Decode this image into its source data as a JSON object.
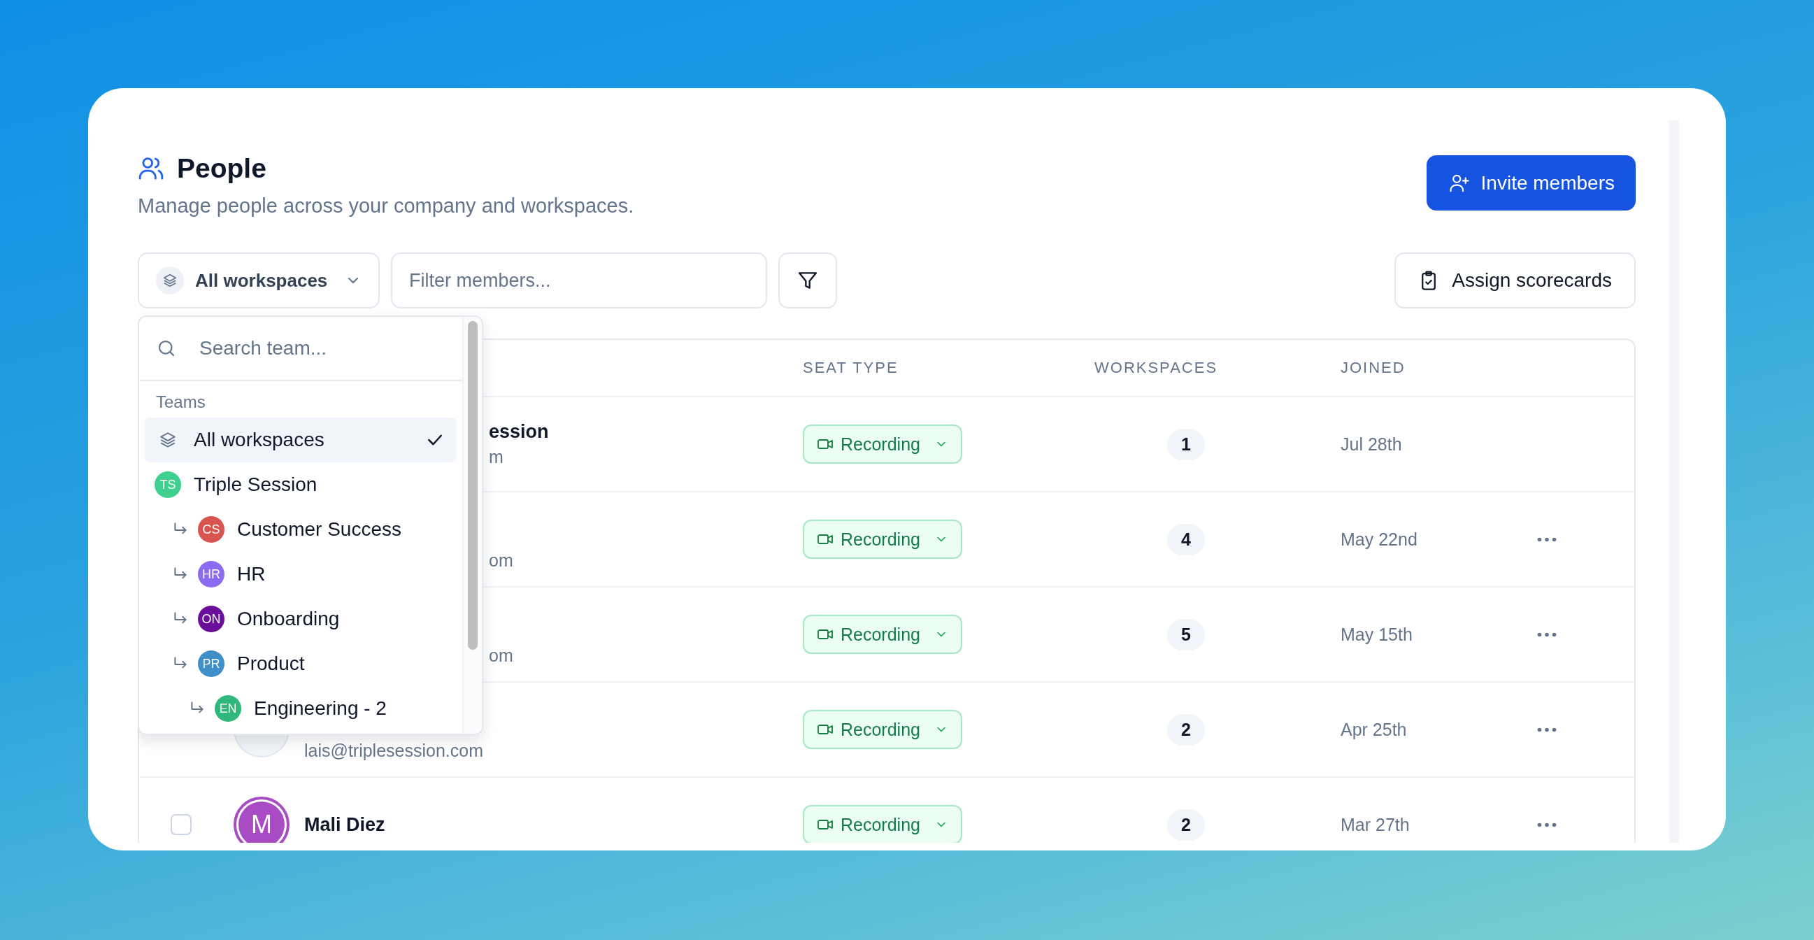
{
  "header": {
    "title": "People",
    "subtitle": "Manage people across your company and workspaces.",
    "invite_button": "Invite members"
  },
  "toolbar": {
    "workspace_select": "All workspaces",
    "filter": {
      "placeholder": "Filter members..."
    },
    "assign_button": "Assign scorecards"
  },
  "table": {
    "columns": [
      "SEAT TYPE",
      "WORKSPACES",
      "JOINED"
    ],
    "rows": [
      {
        "name": "ession",
        "email": "m",
        "seat": "Recording",
        "workspaces": "1",
        "joined": "Jul 28th",
        "has_menu": false
      },
      {
        "email": "om",
        "seat": "Recording",
        "workspaces": "4",
        "joined": "May 22nd",
        "has_menu": true
      },
      {
        "email": "om",
        "seat": "Recording",
        "workspaces": "5",
        "joined": "May 15th",
        "has_menu": true
      },
      {
        "avatar": {
          "kind": "blank"
        },
        "email": "lais@triplesession.com",
        "seat": "Recording",
        "workspaces": "2",
        "joined": "Apr 25th",
        "has_menu": true
      },
      {
        "checked": false,
        "avatar": {
          "kind": "initial",
          "initial": "M",
          "color": "#a94cc4"
        },
        "name": "Mali Diez",
        "seat": "Recording",
        "workspaces": "2",
        "joined": "Mar 27th",
        "has_menu": true
      }
    ]
  },
  "dropdown": {
    "search": {
      "placeholder": "Search team..."
    },
    "section": "Teams",
    "items": [
      {
        "kind": "all",
        "label": "All workspaces",
        "selected": true
      },
      {
        "kind": "team",
        "label": "Triple Session",
        "initials": "TS",
        "color": "#3fcf8e",
        "selected": false,
        "children": [
          {
            "kind": "team",
            "label": "Customer Success",
            "initials": "CS",
            "color": "#d9534f",
            "selected": false
          },
          {
            "kind": "team",
            "label": "HR",
            "initials": "HR",
            "color": "#8b6cf0",
            "selected": false
          },
          {
            "kind": "team",
            "label": "Onboarding",
            "initials": "ON",
            "color": "#6a0f9a",
            "selected": false
          },
          {
            "kind": "team",
            "label": "Product",
            "initials": "PR",
            "color": "#3f8fc8",
            "selected": false,
            "children": [
              {
                "kind": "team",
                "label": "Engineering - 2",
                "initials": "EN",
                "color": "#2fb87a",
                "selected": false
              }
            ]
          }
        ]
      }
    ]
  }
}
